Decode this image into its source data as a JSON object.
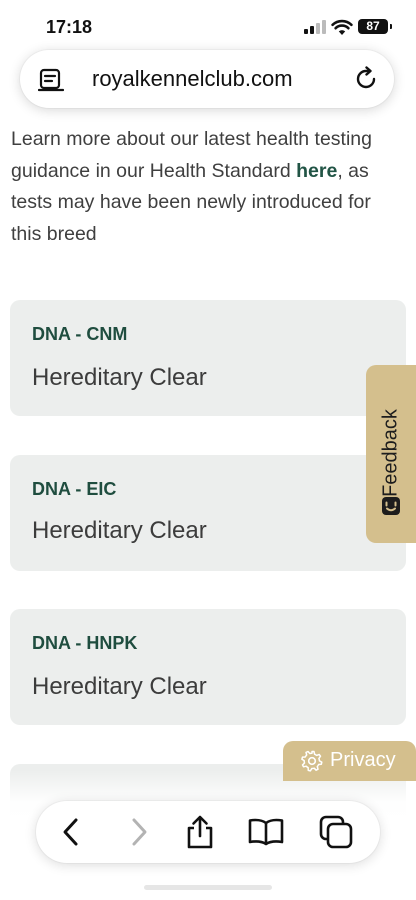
{
  "status_bar": {
    "time": "17:18",
    "battery": "87"
  },
  "browser": {
    "url": "royalkennelclub.com"
  },
  "intro": {
    "before_link": "Learn more about our latest health testing guidance in our Health Standard ",
    "link_text": "here",
    "after_link": ", as tests may have been newly introduced for this breed"
  },
  "cards": [
    {
      "title": "DNA - CNM",
      "value": "Hereditary Clear"
    },
    {
      "title": "DNA - EIC",
      "value": "Hereditary Clear"
    },
    {
      "title": "DNA - HNPK",
      "value": "Hereditary Clear"
    }
  ],
  "feedback_tab": {
    "label": "Feedback"
  },
  "privacy_tab": {
    "label": "Privacy"
  },
  "toolbar": {
    "icons": [
      "back-icon",
      "forward-icon",
      "share-icon",
      "bookmarks-icon",
      "tabs-icon"
    ]
  },
  "colors": {
    "accent_green": "#1f4d3f",
    "tab_gold": "#d4bf8d",
    "card_bg": "#eceeed"
  }
}
